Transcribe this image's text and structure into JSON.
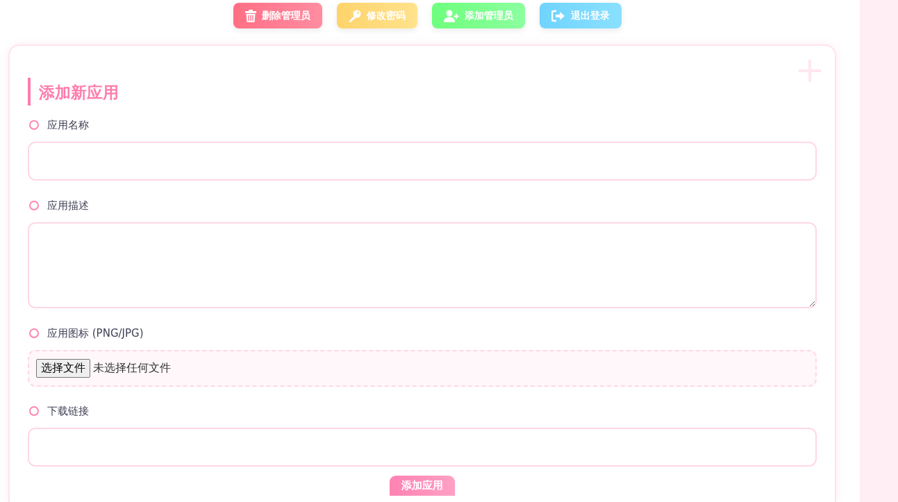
{
  "toolbar": {
    "buttons": [
      {
        "label": "删除管理员",
        "kind": "delete"
      },
      {
        "label": "修改密码",
        "kind": "password"
      },
      {
        "label": "添加管理员",
        "kind": "add"
      },
      {
        "label": "退出登录",
        "kind": "logout"
      }
    ]
  },
  "form": {
    "title": "添加新应用",
    "fields": [
      {
        "label": "应用名称",
        "kind": "text"
      },
      {
        "label": "应用描述",
        "kind": "textarea"
      },
      {
        "label": "应用图标 (PNG/JPG)",
        "kind": "file",
        "button": "选择文件",
        "status": "未选择任何文件"
      },
      {
        "label": "下载链接",
        "kind": "text"
      }
    ],
    "submit": "添加应用"
  }
}
